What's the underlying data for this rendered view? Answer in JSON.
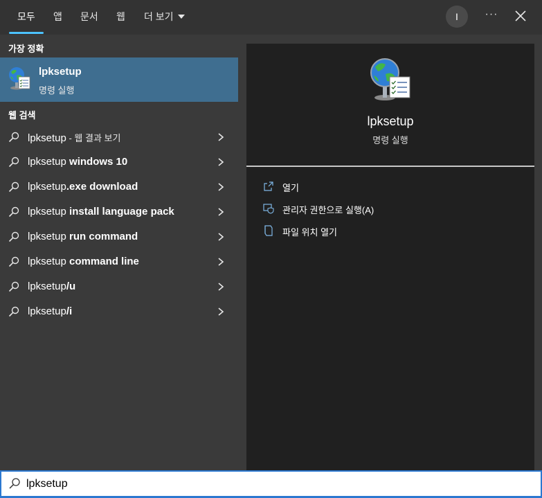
{
  "tabs": [
    {
      "label": "모두"
    },
    {
      "label": "앱"
    },
    {
      "label": "문서"
    },
    {
      "label": "웹"
    },
    {
      "label": "더 보기"
    }
  ],
  "user": {
    "initial": "I"
  },
  "more_options_label": "···",
  "best_match": {
    "section_label": "가장 정확",
    "title": "lpksetup",
    "subtitle": "명령 실행"
  },
  "web_search": {
    "section_label": "웹 검색",
    "items": [
      {
        "query": "lpksetup",
        "suffix": " - 웹 결과 보기"
      },
      {
        "query": "lpksetup",
        "suffix": " windows 10"
      },
      {
        "query": "lpksetup",
        "suffix": ".exe download"
      },
      {
        "query": "lpksetup",
        "suffix": " install language pack"
      },
      {
        "query": "lpksetup",
        "suffix": " run command"
      },
      {
        "query": "lpksetup",
        "suffix": " command line"
      },
      {
        "query": "lpksetup",
        "suffix": "/u"
      },
      {
        "query": "lpksetup",
        "suffix": "/i"
      }
    ]
  },
  "detail": {
    "title": "lpksetup",
    "subtitle": "명령 실행",
    "actions": [
      {
        "label": "열기",
        "icon": "open-icon"
      },
      {
        "label": "관리자 권한으로 실행(A)",
        "icon": "shield-icon"
      },
      {
        "label": "파일 위치 열기",
        "icon": "folder-icon"
      }
    ]
  },
  "search": {
    "value": "lpksetup"
  },
  "colors": {
    "accent": "#4cc2ff",
    "selected_bg": "#3f6e90",
    "search_border": "#2b78d0"
  }
}
